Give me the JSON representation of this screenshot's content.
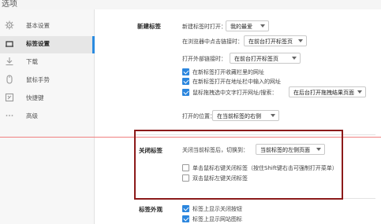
{
  "window": {
    "title": "选项"
  },
  "sidebar": {
    "items": [
      {
        "label": "基本设置",
        "icon": "gear-icon"
      },
      {
        "label": "标签设置",
        "icon": "tab-icon",
        "active": true
      },
      {
        "label": "下载",
        "icon": "download-icon"
      },
      {
        "label": "鼠标手势",
        "icon": "mouse-icon"
      },
      {
        "label": "快捷键",
        "icon": "keyboard-icon"
      },
      {
        "label": "高级",
        "icon": "more-icon"
      }
    ]
  },
  "new_tab": {
    "title": "新建标签",
    "open_on_new_label": "新建标签时打开：",
    "open_on_new_value": "我的最爱",
    "middle_click_label": "在浏览器中点击链接时：",
    "middle_click_value": "在前台打开标签页",
    "external_link_label": "打开外部链接时：",
    "external_link_value": "在前台打开标签页",
    "cb_favorites": "在新标签打开收藏栏里的网址",
    "cb_addressbar": "在新标签打开在地址栏中输入的网址",
    "cb_drag_label": "鼠标拖拽选中文字打开网址/搜索：",
    "drag_value": "在后台打开拖拽结果页面",
    "position_label": "打开的位置：",
    "position_value": "在当前标签的右侧"
  },
  "close_tab": {
    "title": "关闭标签",
    "after_close_label": "关闭当前标签后，切换到：",
    "after_close_value": "当前标签的左侧页面",
    "cb_right_click": "单击鼠标右键关闭标签（按住Shift键右击可强制打开菜单）",
    "cb_double_click": "双击鼠标左键关闭标签"
  },
  "appearance": {
    "title": "标签外观",
    "cb_close_button": "标签上显示关闭按钮",
    "cb_favicon": "标签上显示网站图标"
  },
  "colors": {
    "accent": "#2b86de",
    "highlight_box": "#8c1a1a",
    "red_line": "#f08080"
  }
}
